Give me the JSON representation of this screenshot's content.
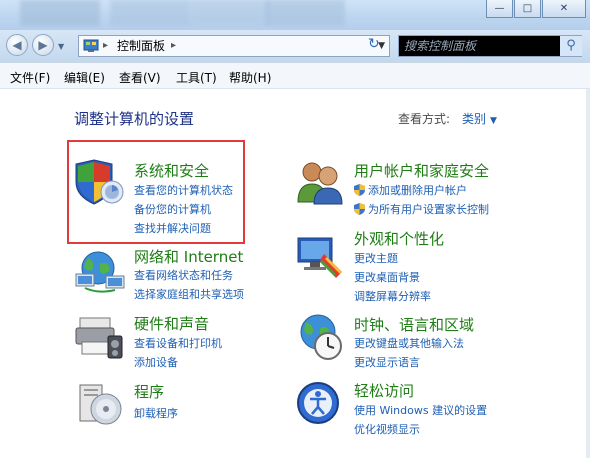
{
  "window": {
    "buttons": {
      "minimize": "—",
      "maximize": "□",
      "close": "✕"
    }
  },
  "address_bar": {
    "back_icon": "back-arrow-icon",
    "forward_icon": "forward-arrow-icon",
    "path": "控制面板",
    "search_placeholder": "搜索控制面板"
  },
  "menu": [
    {
      "label": "文件(F)"
    },
    {
      "label": "编辑(E)"
    },
    {
      "label": "查看(V)"
    },
    {
      "label": "工具(T)"
    },
    {
      "label": "帮助(H)"
    }
  ],
  "content": {
    "heading": "调整计算机的设置",
    "view_by_label": "查看方式:",
    "view_by_value": "类别"
  },
  "categories": {
    "system_security": {
      "title": "系统和安全",
      "links": [
        "查看您的计算机状态",
        "备份您的计算机",
        "查找并解决问题"
      ]
    },
    "network": {
      "title": "网络和 Internet",
      "links": [
        "查看网络状态和任务",
        "选择家庭组和共享选项"
      ]
    },
    "hardware": {
      "title": "硬件和声音",
      "links": [
        "查看设备和打印机",
        "添加设备"
      ]
    },
    "programs": {
      "title": "程序",
      "links": [
        "卸载程序"
      ]
    },
    "user_accounts": {
      "title": "用户帐户和家庭安全",
      "links": [
        "添加或删除用户帐户",
        "为所有用户设置家长控制"
      ]
    },
    "appearance": {
      "title": "外观和个性化",
      "links": [
        "更改主题",
        "更改桌面背景",
        "调整屏幕分辨率"
      ]
    },
    "clock_region": {
      "title": "时钟、语言和区域",
      "links": [
        "更改键盘或其他输入法",
        "更改显示语言"
      ]
    },
    "ease_of_access": {
      "title": "轻松访问",
      "links": [
        "使用 Windows 建议的设置",
        "优化视频显示"
      ]
    }
  },
  "colors": {
    "category_title": "#1e7d15",
    "link": "#1e5fb4",
    "heading": "#1e3287",
    "highlight_box": "#e03a3a"
  }
}
